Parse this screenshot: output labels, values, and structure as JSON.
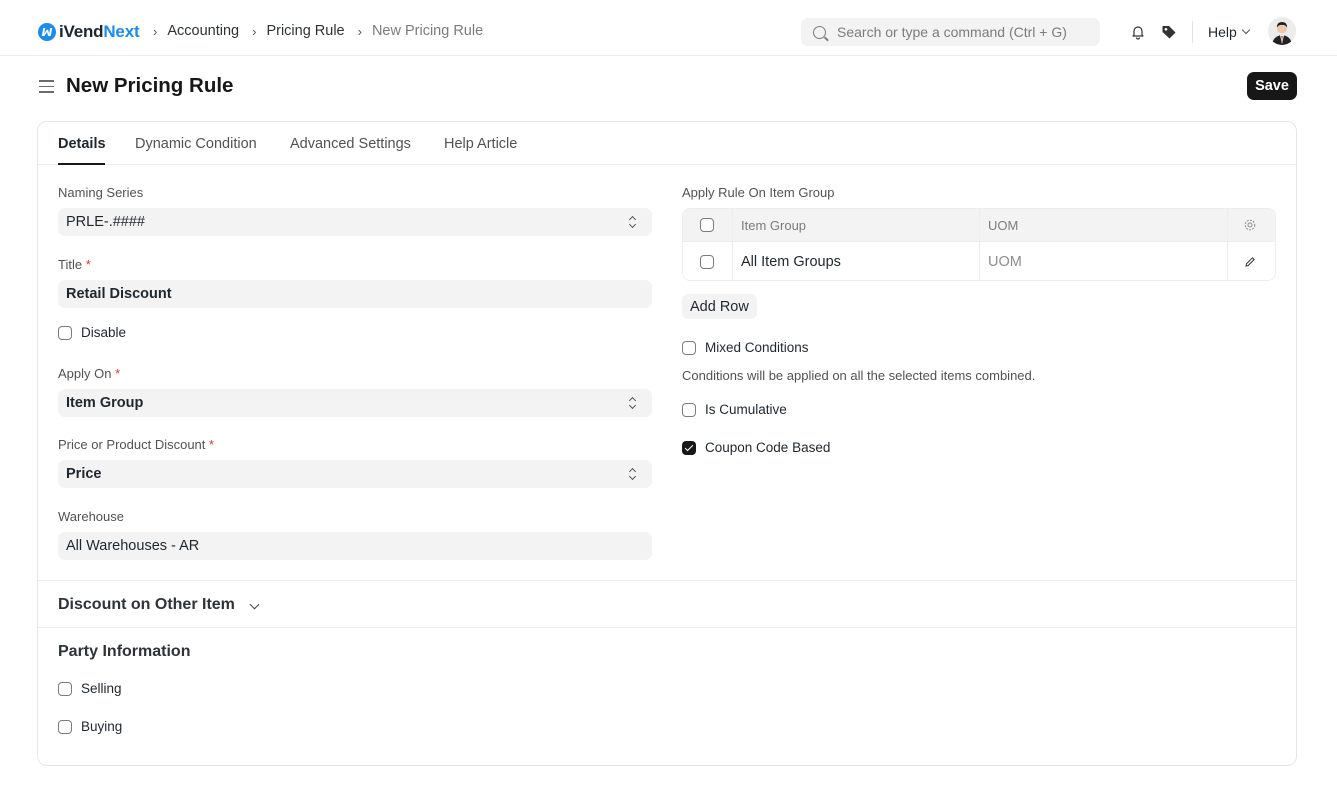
{
  "app": {
    "brand_prefix": "iVend",
    "brand_suffix": "Next",
    "brand_color": "#1a8cf0",
    "logo_icon": "ivend-logo-icon"
  },
  "breadcrumbs": [
    {
      "label": "Accounting"
    },
    {
      "label": "Pricing Rule"
    },
    {
      "label": "New Pricing Rule"
    }
  ],
  "navbar": {
    "search_placeholder": "Search or type a command (Ctrl + G)",
    "notifications_icon": "bell-icon",
    "tags_icon": "tag-icon",
    "help_label": "Help",
    "avatar": "user-avatar"
  },
  "page": {
    "title": "New Pricing Rule",
    "save_label": "Save"
  },
  "tabs": [
    {
      "label": "Details",
      "active": true
    },
    {
      "label": "Dynamic Condition",
      "active": false
    },
    {
      "label": "Advanced Settings",
      "active": false
    },
    {
      "label": "Help Article",
      "active": false
    }
  ],
  "form": {
    "naming_series": {
      "label": "Naming Series",
      "value": "PRLE-.####"
    },
    "title": {
      "label": "Title",
      "required_mark": "*",
      "value": "Retail Discount"
    },
    "disable": {
      "label": "Disable",
      "checked": false
    },
    "apply_on": {
      "label": "Apply On",
      "required_mark": "*",
      "value": "Item Group"
    },
    "price_or_product": {
      "label": "Price or Product Discount",
      "required_mark": "*",
      "value": "Price"
    },
    "warehouse": {
      "label": "Warehouse",
      "value": "All Warehouses - AR"
    },
    "apply_rule_on_item_group": {
      "label": "Apply Rule On Item Group",
      "columns": [
        "Item Group",
        "UOM"
      ],
      "rows": [
        {
          "item_group": "All Item Groups",
          "uom": "UOM"
        }
      ],
      "add_row_label": "Add Row"
    },
    "mixed_conditions": {
      "label": "Mixed Conditions",
      "checked": false,
      "description": "Conditions will be applied on all the selected items combined."
    },
    "is_cumulative": {
      "label": "Is Cumulative",
      "checked": false
    },
    "coupon_code_based": {
      "label": "Coupon Code Based",
      "checked": true
    }
  },
  "sections": {
    "discount_on_other_item": {
      "title": "Discount on Other Item",
      "collapsed": true
    },
    "party_information": {
      "title": "Party Information",
      "selling": {
        "label": "Selling",
        "checked": false
      },
      "buying": {
        "label": "Buying",
        "checked": false
      }
    }
  }
}
